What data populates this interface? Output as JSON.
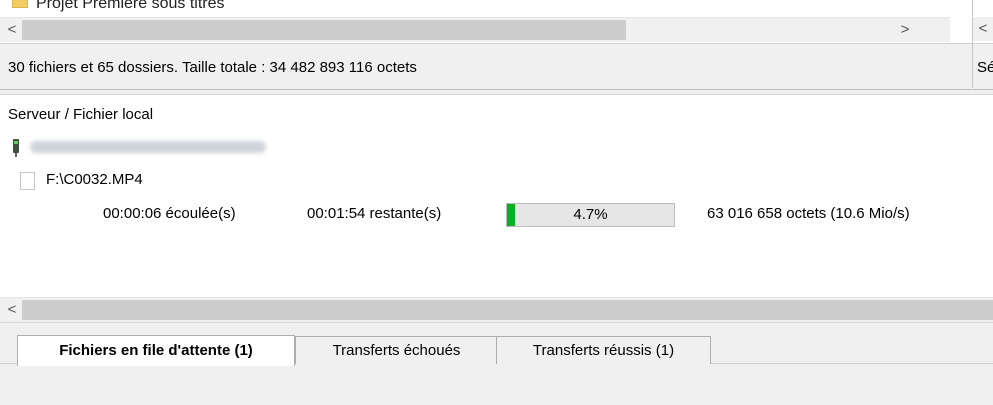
{
  "local_pane": {
    "partial_item": "Projet Premiere sous titres",
    "status": "30 fichiers et 65 dossiers. Taille totale : 34 482 893 116 octets"
  },
  "remote_pane": {
    "status_partial": "Sé"
  },
  "scroll": {
    "left_arrow": "<",
    "right_arrow": ">"
  },
  "queue": {
    "column_header": "Serveur / Fichier local",
    "file": "F:\\C0032.MP4",
    "elapsed": "00:00:06 écoulée(s)",
    "remaining": "00:01:54 restante(s)",
    "progress_percent": 4.7,
    "progress_label": "4.7%",
    "transferred": "63 016 658 octets (10.6 Mio/s)"
  },
  "tabs": [
    {
      "label": "Fichiers en file d'attente (1)",
      "active": true
    },
    {
      "label": "Transferts échoués",
      "active": false
    },
    {
      "label": "Transferts réussis (1)",
      "active": false
    }
  ],
  "colors": {
    "progress": "#06b025",
    "folder": "#f2cb63"
  }
}
